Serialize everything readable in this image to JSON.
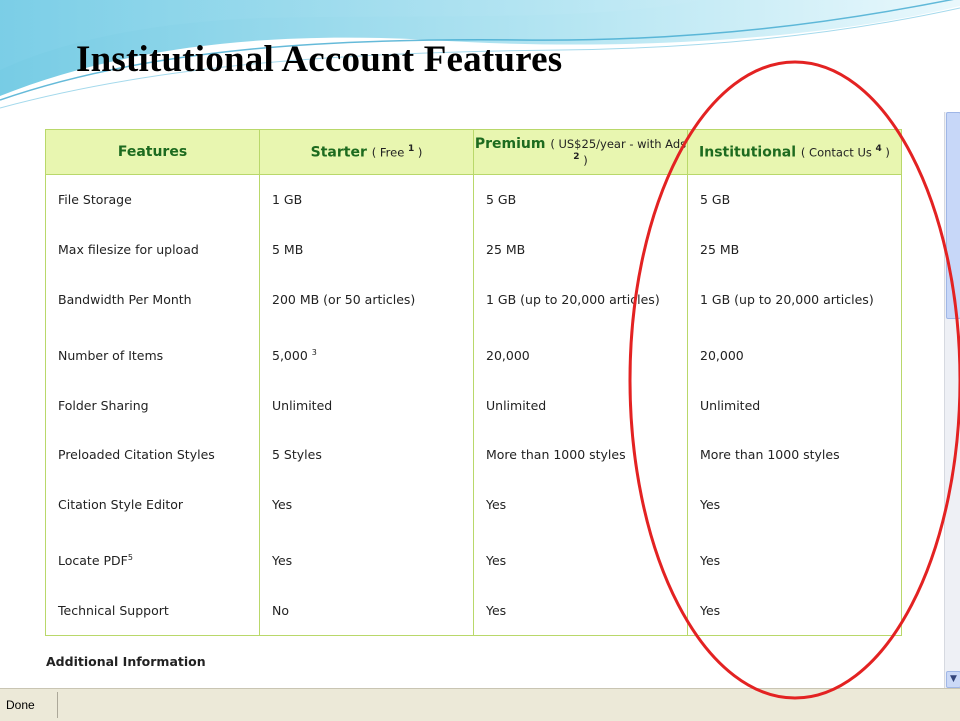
{
  "slide": {
    "title": "Institutional Account Features"
  },
  "table": {
    "headers": [
      {
        "name": "Features",
        "sub": "",
        "sup": "",
        "sub_end": ""
      },
      {
        "name": "Starter",
        "sub": "( Free ",
        "sup": "1",
        "sub_end": " )"
      },
      {
        "name": "Premium",
        "sub": "( US$25/year - with Ads ",
        "sup": "2",
        "sub_end": " )"
      },
      {
        "name": "Institutional",
        "sub": "( Contact Us ",
        "sup": "4",
        "sub_end": " )"
      }
    ],
    "rows": [
      {
        "feature": "File Storage",
        "starter": "1 GB",
        "premium": "5 GB",
        "institutional": "5 GB"
      },
      {
        "feature": "Max filesize for upload",
        "starter": "5 MB",
        "premium": "25 MB",
        "institutional": "25 MB"
      },
      {
        "feature": "Bandwidth Per Month",
        "starter": "200 MB (or 50 articles)",
        "premium": "1 GB (up to 20,000 articles)",
        "institutional": "1 GB (up to 20,000 articles)"
      },
      {
        "feature": "Number of Items",
        "starter": "5,000",
        "starter_sup": "3",
        "premium": "20,000",
        "institutional": "20,000"
      },
      {
        "feature": "Folder Sharing",
        "starter": "Unlimited",
        "premium": "Unlimited",
        "institutional": "Unlimited"
      },
      {
        "feature": "Preloaded Citation Styles",
        "starter": "5 Styles",
        "premium": "More than 1000 styles",
        "institutional": "More than 1000 styles"
      },
      {
        "feature": "Citation Style Editor",
        "starter": "Yes",
        "premium": "Yes",
        "institutional": "Yes"
      },
      {
        "feature": "Locate PDF",
        "feature_sup": "5",
        "starter": "Yes",
        "premium": "Yes",
        "institutional": "Yes"
      },
      {
        "feature": "Technical Support",
        "starter": "No",
        "premium": "Yes",
        "institutional": "Yes"
      }
    ]
  },
  "additional_info": "Additional Information",
  "status_bar": {
    "text": "Done"
  },
  "scrollbar": {
    "down_arrow_icon": "chevron-down-icon"
  },
  "colors": {
    "header_bg": "#e8f6b0",
    "header_text": "#1d6b1f",
    "border": "#b9d86a",
    "highlight_circle": "#e32222"
  }
}
